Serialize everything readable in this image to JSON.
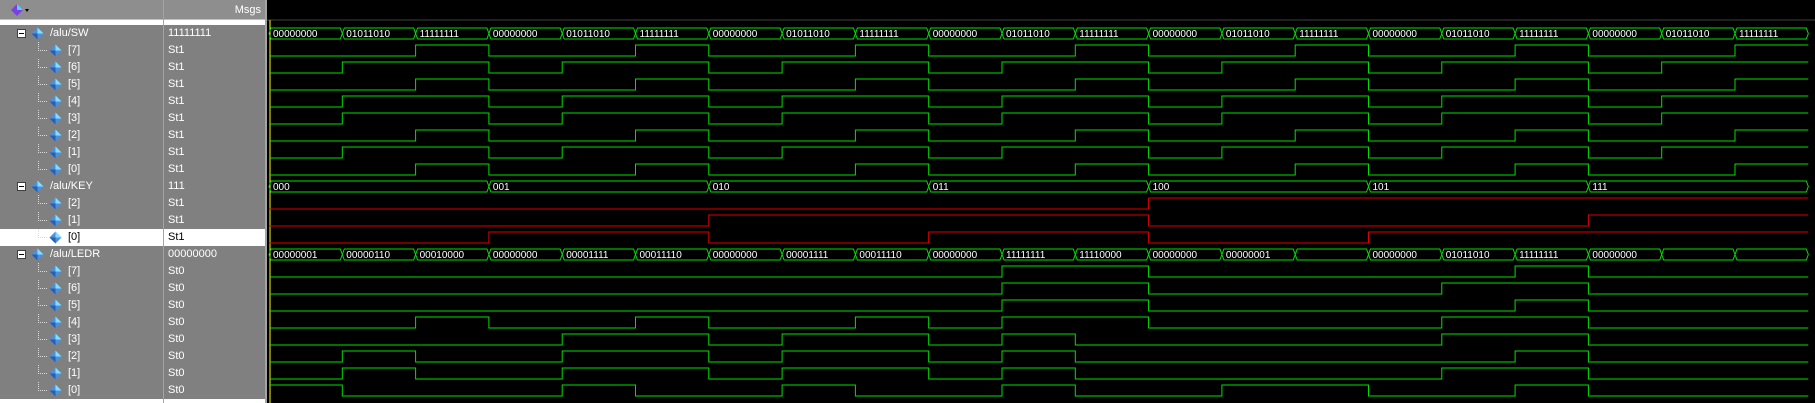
{
  "header": {
    "msgs_label": "Msgs"
  },
  "signals": [
    {
      "name": "/alu/SW",
      "value": "11111111",
      "kind": "group",
      "color": "green"
    },
    {
      "name": "[7]",
      "value": "St1",
      "kind": "bit",
      "color": "green"
    },
    {
      "name": "[6]",
      "value": "St1",
      "kind": "bit",
      "color": "green"
    },
    {
      "name": "[5]",
      "value": "St1",
      "kind": "bit",
      "color": "green"
    },
    {
      "name": "[4]",
      "value": "St1",
      "kind": "bit",
      "color": "green"
    },
    {
      "name": "[3]",
      "value": "St1",
      "kind": "bit",
      "color": "green"
    },
    {
      "name": "[2]",
      "value": "St1",
      "kind": "bit",
      "color": "green"
    },
    {
      "name": "[1]",
      "value": "St1",
      "kind": "bit",
      "color": "green"
    },
    {
      "name": "[0]",
      "value": "St1",
      "kind": "bit",
      "color": "green"
    },
    {
      "name": "/alu/KEY",
      "value": "111",
      "kind": "group",
      "color": "green"
    },
    {
      "name": "[2]",
      "value": "St1",
      "kind": "bit",
      "color": "red"
    },
    {
      "name": "[1]",
      "value": "St1",
      "kind": "bit",
      "color": "red"
    },
    {
      "name": "[0]",
      "value": "St1",
      "kind": "bit",
      "color": "red",
      "selected": true
    },
    {
      "name": "/alu/LEDR",
      "value": "00000000",
      "kind": "group",
      "color": "green"
    },
    {
      "name": "[7]",
      "value": "St0",
      "kind": "bit",
      "color": "green"
    },
    {
      "name": "[6]",
      "value": "St0",
      "kind": "bit",
      "color": "green"
    },
    {
      "name": "[5]",
      "value": "St0",
      "kind": "bit",
      "color": "green"
    },
    {
      "name": "[4]",
      "value": "St0",
      "kind": "bit",
      "color": "green"
    },
    {
      "name": "[3]",
      "value": "St0",
      "kind": "bit",
      "color": "green"
    },
    {
      "name": "[2]",
      "value": "St0",
      "kind": "bit",
      "color": "green"
    },
    {
      "name": "[1]",
      "value": "St0",
      "kind": "bit",
      "color": "green"
    },
    {
      "name": "[0]",
      "value": "St0",
      "kind": "bit",
      "color": "green"
    }
  ],
  "buses": {
    "sw": [
      "00000000",
      "01011010",
      "11111111",
      "00000000",
      "01011010",
      "11111111",
      "00000000",
      "01011010",
      "11111111",
      "00000000",
      "01011010",
      "11111111",
      "00000000",
      "01011010",
      "11111111",
      "00000000",
      "01011010",
      "11111111",
      "00000000",
      "01011010",
      "11111111"
    ],
    "key": [
      "000",
      "001",
      "010",
      "011",
      "100",
      "101",
      "111"
    ],
    "ledr": [
      "00000001",
      "00000110",
      "00010000",
      "00000000",
      "00001111",
      "00011110",
      "00000000",
      "00001111",
      "00011110",
      "00000000",
      "11111111",
      "11110000",
      "00000000",
      "00000001",
      "",
      "00000000",
      "01011010",
      "11111111",
      "00000000",
      "",
      ""
    ]
  },
  "colors": {
    "wave_green": "#00e000",
    "wave_red": "#e00000",
    "bus_text": "#ffffff",
    "cursor": "#ffff00"
  }
}
